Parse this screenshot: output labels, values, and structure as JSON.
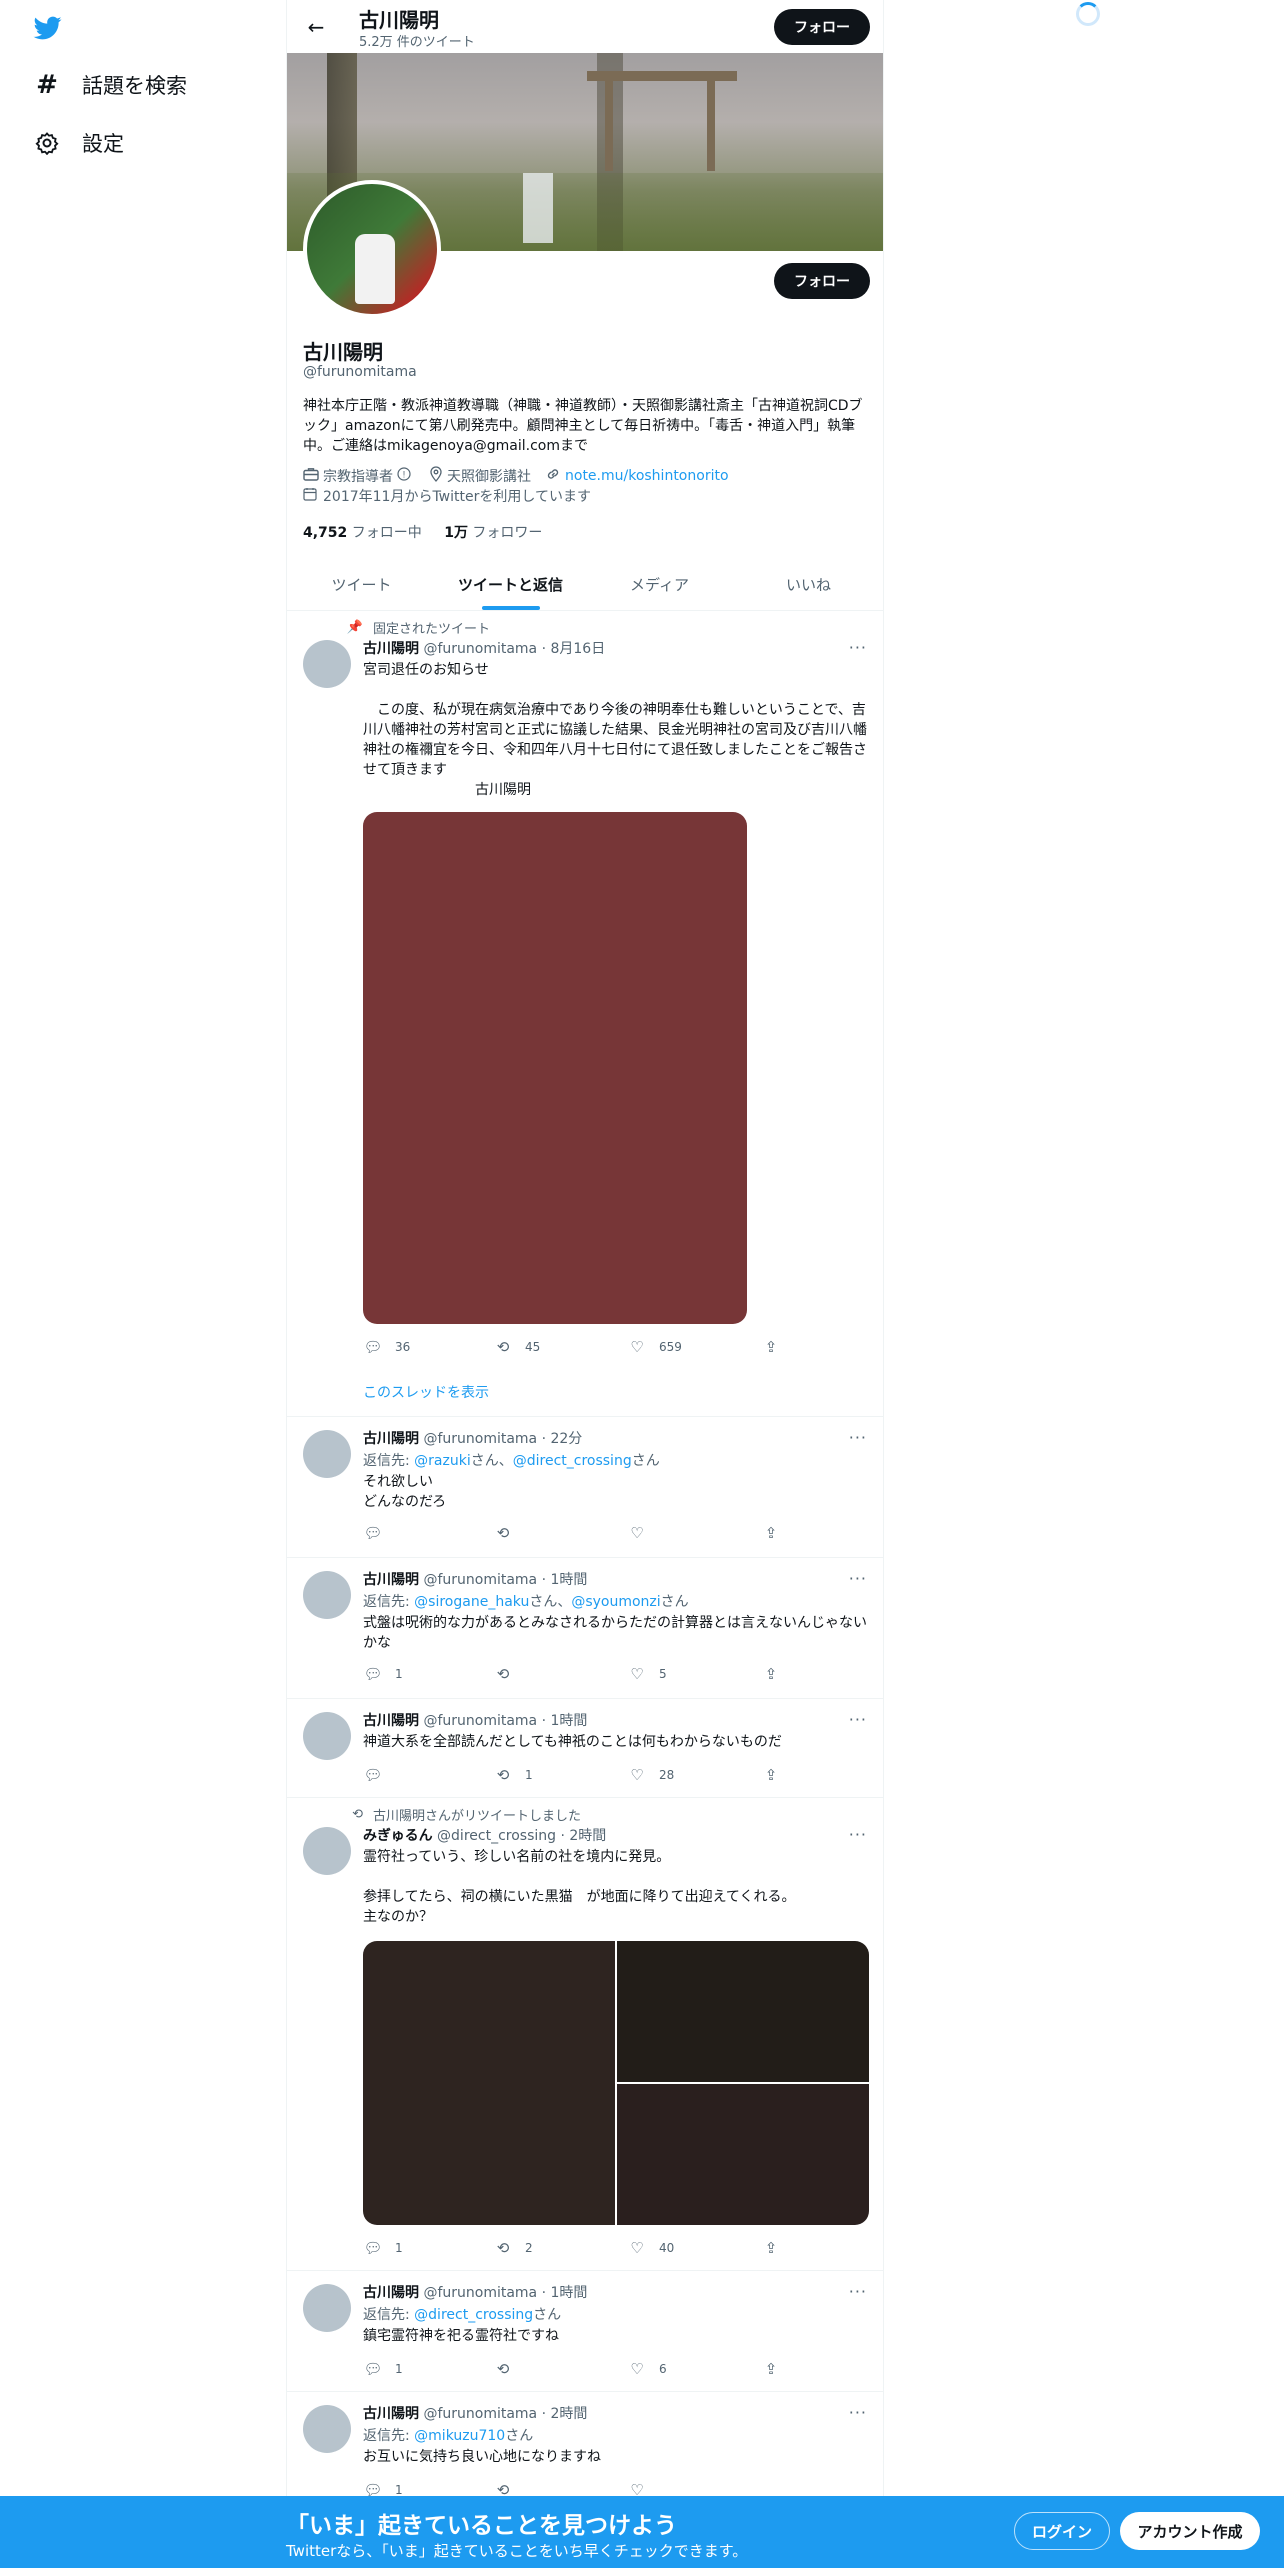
{
  "nav": {
    "logo": "twitter-bird-icon",
    "items": [
      {
        "label": "話題を検索",
        "icon": "hashtag-icon"
      },
      {
        "label": "設定",
        "icon": "gear-icon"
      }
    ]
  },
  "header": {
    "name": "古川陽明",
    "tweet_count": "5.2万 件のツイート",
    "follow_label": "フォロー"
  },
  "profile": {
    "name": "古川陽明",
    "handle": "@furunomitama",
    "follow_label": "フォロー",
    "bio": "神社本庁正階・教派神道教導職（神職・神道教師）・天照御影講社斎主「古神道祝詞CDブック」amazonにて第八刷発売中。顧問神主として毎日祈祷中。「毒舌・神道入門」執筆中。ご連絡はmikagenoya@gmail.comまで",
    "category": "宗教指導者",
    "location": "天照御影講社",
    "url": "note.mu/koshintonorito",
    "joined": "2017年11月からTwitterを利用しています",
    "following_count": "4,752",
    "following_label": "フォロー中",
    "followers_count": "1万",
    "followers_label": "フォロワー"
  },
  "tabs": [
    {
      "label": "ツイート",
      "active": false
    },
    {
      "label": "ツイートと返信",
      "active": true
    },
    {
      "label": "メディア",
      "active": false
    },
    {
      "label": "いいね",
      "active": false
    }
  ],
  "tweets": [
    {
      "social": "固定されたツイート",
      "name": "古川陽明",
      "meta": "@furunomitama · 8月16日",
      "text": "宮司退任のお知らせ\n\n　この度、私が現在病気治療中であり今後の神明奉仕も難しいということで、吉川八幡神社の芳村宮司と正式に協議した結果、艮金光明神社の宮司及び吉川八幡神社の権禰宜を今日、令和四年八月十七日付にて退任致しましたことをご報告させて頂きます\n　　　　　　　　古川陽明",
      "replies": "36",
      "retweets": "45",
      "likes": "659",
      "thread_link": "このスレッドを表示"
    },
    {
      "name": "古川陽明",
      "meta": "@furunomitama · 22分",
      "reply_prefix": "返信先: ",
      "reply_to_1": "@razuki",
      "reply_sep_1": "さん、",
      "reply_to_2": "@direct_crossing",
      "reply_suffix": "さん",
      "text": "それ欲しい\nどんなのだろ",
      "replies": "",
      "retweets": "",
      "likes": ""
    },
    {
      "name": "古川陽明",
      "meta": "@furunomitama · 1時間",
      "reply_prefix": "返信先: ",
      "reply_to_1": "@sirogane_haku",
      "reply_sep_1": "さん、",
      "reply_to_2": "@syoumonzi",
      "reply_suffix": "さん",
      "text": "式盤は呪術的な力があるとみなされるからただの計算器とは言えないんじゃないかな",
      "replies": "1",
      "retweets": "",
      "likes": "5"
    },
    {
      "name": "古川陽明",
      "meta": "@furunomitama · 1時間",
      "text": "神道大系を全部読んだとしても神祇のことは何もわからないものだ",
      "replies": "",
      "retweets": "1",
      "likes": "28"
    },
    {
      "social": "古川陽明さんがリツイートしました",
      "name": "みぎゅるん",
      "meta": "@direct_crossing · 2時間",
      "text": "霊符社っていう、珍しい名前の社を境内に発見。\n\n参拝してたら、祠の横にいた黒猫　が地面に降りて出迎えてくれる。\n主なのか？",
      "replies": "1",
      "retweets": "2",
      "likes": "40"
    },
    {
      "name": "古川陽明",
      "meta": "@furunomitama · 1時間",
      "reply_prefix": "返信先: ",
      "reply_to_1": "@direct_crossing",
      "reply_suffix": "さん",
      "text": "鎮宅霊符神を祀る霊符社ですね",
      "replies": "1",
      "retweets": "",
      "likes": "6"
    },
    {
      "name": "古川陽明",
      "meta": "@furunomitama · 2時間",
      "reply_prefix": "返信先: ",
      "reply_to_1": "@mikuzu710",
      "reply_suffix": "さん",
      "text": "お互いに気持ち良い心地になりますね",
      "replies": "1",
      "retweets": "",
      "likes": ""
    }
  ],
  "bottom_bar": {
    "title": "「いま」起きていることを見つけよう",
    "subtitle": "Twitterなら、「いま」起きていることをいち早くチェックできます。",
    "login": "ログイン",
    "signup": "アカウント作成"
  },
  "colors": {
    "accent": "#1d9bf0",
    "banner_bar": "#1d9bf0",
    "text": "#0f1419",
    "muted": "#536471"
  }
}
